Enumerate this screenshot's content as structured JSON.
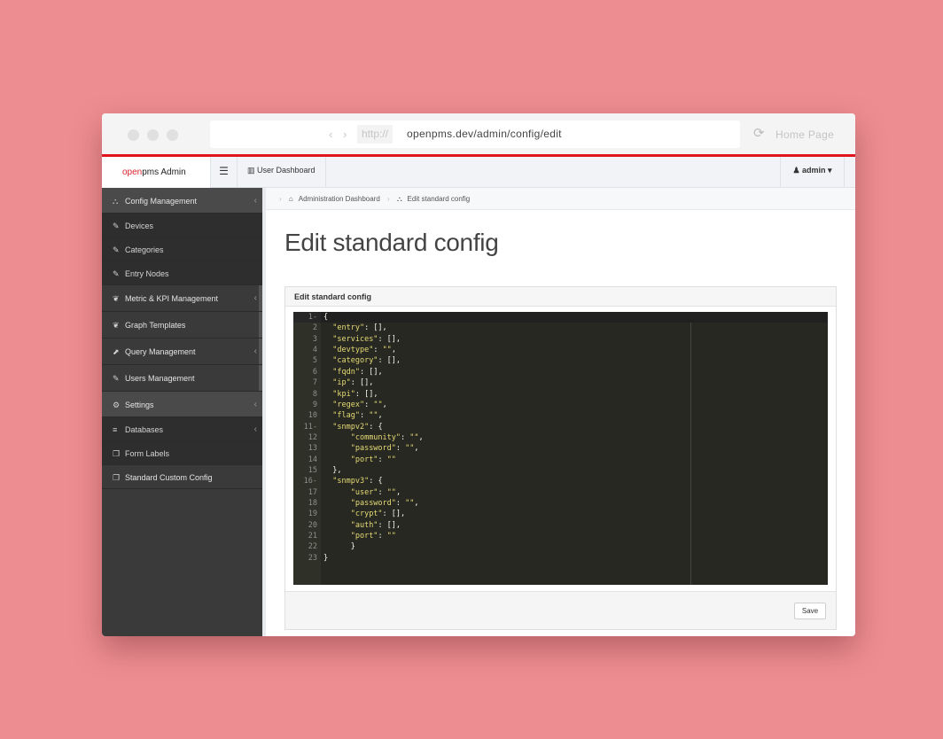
{
  "browser": {
    "nav_arrows": "‹ ›",
    "protocol": "http://",
    "url": "openpms.dev/admin/config/edit",
    "home_label": "Home Page"
  },
  "topbar": {
    "brand_open": "open",
    "brand_rest": "pms Admin",
    "menu_icon": "☰",
    "dashboard_label": "User Dashboard",
    "user_label": "admin ▾"
  },
  "sidebar": {
    "items": [
      {
        "label": "Config Management",
        "icon": "⛬",
        "type": "header",
        "chevron": "‹"
      },
      {
        "label": "Devices",
        "icon": "✎",
        "type": "sub"
      },
      {
        "label": "Categories",
        "icon": "✎",
        "type": "sub"
      },
      {
        "label": "Entry Nodes",
        "icon": "✎",
        "type": "sub"
      },
      {
        "label": "Metric & KPI Management",
        "icon": "❦",
        "type": "item",
        "chevron": "‹"
      },
      {
        "label": "Graph Templates",
        "icon": "❦",
        "type": "item"
      },
      {
        "label": "Query Management",
        "icon": "⬈",
        "type": "item",
        "chevron": "‹"
      },
      {
        "label": "Users Management",
        "icon": "✎",
        "type": "item"
      },
      {
        "label": "Settings",
        "icon": "⚙",
        "type": "header",
        "chevron": "‹"
      },
      {
        "label": "Databases",
        "icon": "≡",
        "type": "sub",
        "chevron": "‹"
      },
      {
        "label": "Form Labels",
        "icon": "❐",
        "type": "sub"
      },
      {
        "label": "Standard Custom Config",
        "icon": "❐",
        "type": "item"
      }
    ]
  },
  "breadcrumb": {
    "home": "Administration Dashboard",
    "current": "Edit standard config"
  },
  "page_title": "Edit standard config",
  "panel": {
    "title": "Edit standard config",
    "save_label": "Save"
  },
  "editor": {
    "lines": [
      "{",
      "  \"entry\": [],",
      "  \"services\": [],",
      "  \"devtype\": \"\",",
      "  \"category\": [],",
      "  \"fqdn\": [],",
      "  \"ip\": [],",
      "  \"kpi\": [],",
      "  \"regex\": \"\",",
      "  \"flag\": \"\",",
      "  \"snmpv2\": {",
      "      \"community\": \"\",",
      "      \"password\": \"\",",
      "      \"port\": \"\"",
      "  },",
      "  \"snmpv3\": {",
      "      \"user\": \"\",",
      "      \"password\": \"\",",
      "      \"crypt\": [],",
      "      \"auth\": [],",
      "      \"port\": \"\"",
      "      }",
      "}"
    ],
    "fold_lines": [
      1,
      11,
      16
    ]
  }
}
